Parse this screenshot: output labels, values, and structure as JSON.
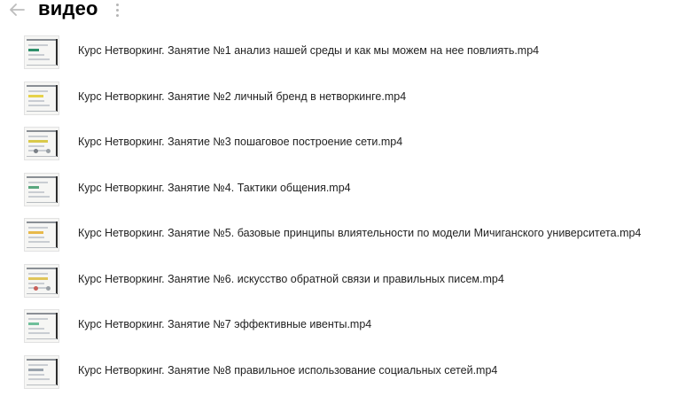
{
  "header": {
    "title": "видео",
    "back_icon": "arrow-left-icon",
    "more_icon": "more-vertical-icon"
  },
  "files": [
    {
      "name": "Курс Нетворкинг. Занятие №1 анализ нашей среды и как мы можем на нее повлиять.mp4",
      "accent": "#2d8f6a"
    },
    {
      "name": "Курс Нетворкинг. Занятие №2 личный бренд в нетворкинге.mp4",
      "accent": "#e6d24a"
    },
    {
      "name": "Курс Нетворкинг. Занятие №3 пошаговое построение сети.mp4",
      "accent": "#d9c94a"
    },
    {
      "name": "Курс Нетворкинг. Занятие №4. Тактики общения.mp4",
      "accent": "#5aa77f"
    },
    {
      "name": "Курс Нетворкинг. Занятие №5. базовые принципы влиятельности по модели Мичиганского университета.mp4",
      "accent": "#e8b94a"
    },
    {
      "name": "Курс Нетворкинг. Занятие №6. искусство обратной связи и правильных писем.mp4",
      "accent": "#e0c55a"
    },
    {
      "name": "Курс Нетворкинг. Занятие №7 эффективные ивенты.mp4",
      "accent": "#6fbf9a"
    },
    {
      "name": "Курс Нетворкинг. Занятие №8 правильное использование социальных сетей.mp4",
      "accent": "#9aa3ad"
    }
  ]
}
